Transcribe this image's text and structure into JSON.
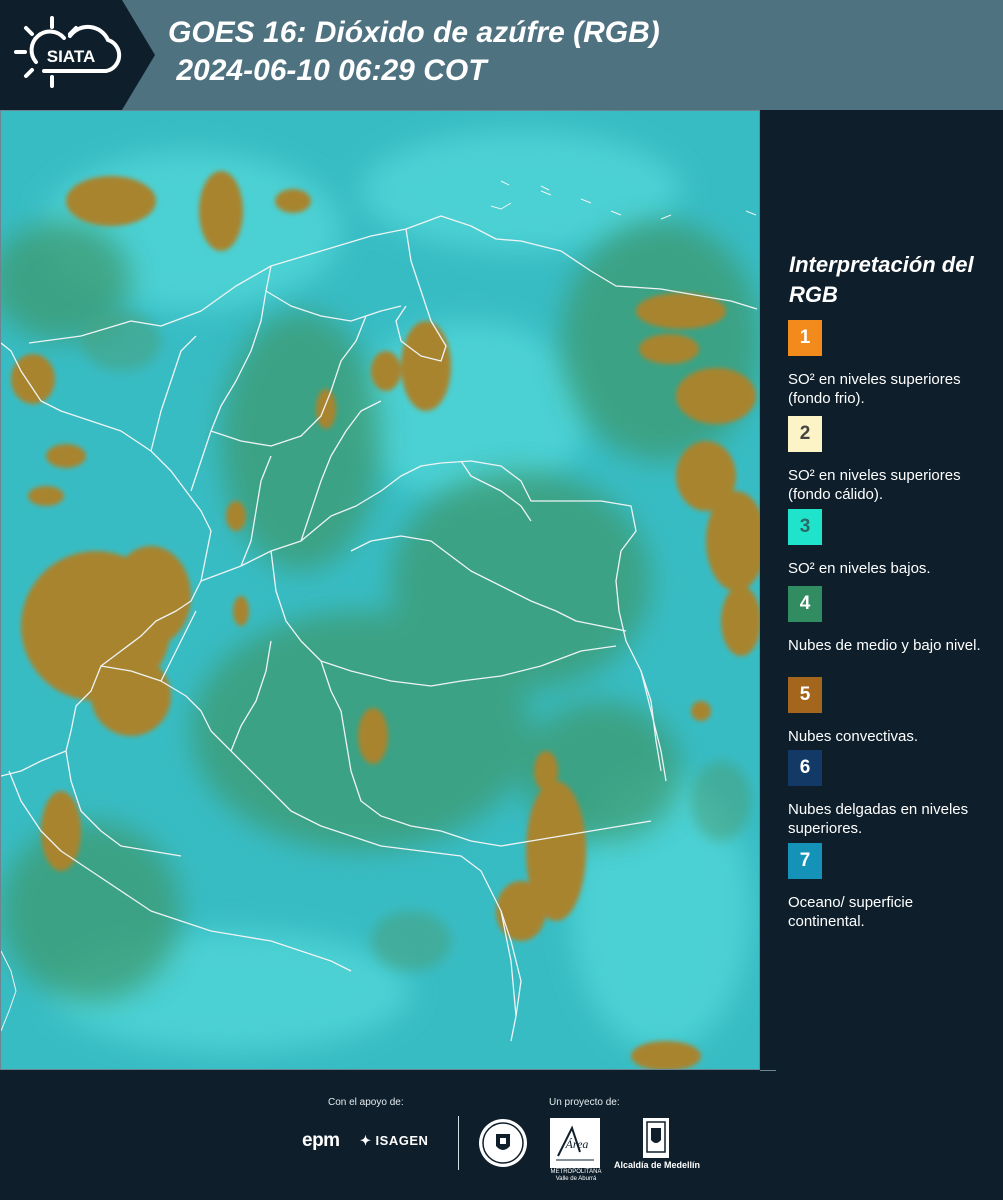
{
  "header": {
    "logo_text": "SIATA",
    "title": "GOES 16: Dióxido de azúfre (RGB)\n 2024-06-10 06:29 COT"
  },
  "map": {
    "icon": "satellite-map-image",
    "colors": {
      "base": "#35b9c3",
      "bright": "#4ed8d8",
      "green": "#3f9872",
      "convective": "#a5822c",
      "border": "#eef4f5"
    }
  },
  "legend": {
    "title": "Interpretación del RGB",
    "items": [
      {
        "number": "1",
        "color": "#f28a1c",
        "text_color": "#ffffff",
        "label": "SO² en niveles superiores (fondo frio)."
      },
      {
        "number": "2",
        "color": "#fcf4c7",
        "text_color": "#444444",
        "label": "SO² en niveles superiores (fondo cálido)."
      },
      {
        "number": "3",
        "color": "#1fe3cb",
        "text_color": "#2a6a66",
        "label": "SO² en niveles bajos."
      },
      {
        "number": "4",
        "color": "#318c62",
        "text_color": "#ffffff",
        "label": "Nubes de medio y bajo nivel."
      },
      {
        "number": "5",
        "color": "#a3661c",
        "text_color": "#ffffff",
        "label": "Nubes convectivas."
      },
      {
        "number": "6",
        "color": "#133a66",
        "text_color": "#ffffff",
        "label": "Nubes delgadas en niveles superiores."
      },
      {
        "number": "7",
        "color": "#1592b7",
        "text_color": "#ffffff",
        "label": "Oceano/ superficie continental."
      }
    ]
  },
  "footer": {
    "support_label": "Con el apoyo de:",
    "project_label": "Un proyecto de:",
    "sponsor_epm": "epm",
    "sponsor_isagen": "ISAGEN",
    "area_caption": "METROPOLITANA Valle de Aburrá",
    "area_wordmark": "Área",
    "alcaldia_caption": "Alcaldía de Medellín"
  }
}
